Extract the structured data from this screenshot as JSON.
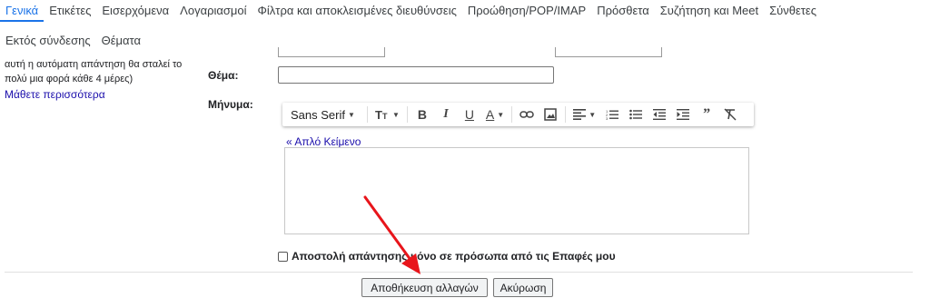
{
  "tabs_primary": [
    {
      "label": "Γενικά",
      "active": true
    },
    {
      "label": "Ετικέτες",
      "active": false
    },
    {
      "label": "Εισερχόμενα",
      "active": false
    },
    {
      "label": "Λογαριασμοί",
      "active": false
    },
    {
      "label": "Φίλτρα και αποκλεισμένες διευθύνσεις",
      "active": false
    },
    {
      "label": "Προώθηση/POP/IMAP",
      "active": false
    },
    {
      "label": "Πρόσθετα",
      "active": false
    },
    {
      "label": "Συζήτηση και Meet",
      "active": false
    },
    {
      "label": "Σύνθετες",
      "active": false
    }
  ],
  "tabs_secondary": [
    {
      "label": "Εκτός σύνδεσης"
    },
    {
      "label": "Θέματα"
    }
  ],
  "left_panel": {
    "note": "αυτή η αυτόματη απάντηση θα σταλεί το πολύ μια φορά κάθε 4 μέρες)",
    "learn_more": "Μάθετε περισσότερα"
  },
  "form": {
    "subject_label": "Θέμα:",
    "subject_value": "",
    "message_label": "Μήνυμα:",
    "plain_text_link": "« Απλό Κείμενο",
    "contacts_only_label": "Αποστολή απάντησης μόνο σε πρόσωπα από τις Επαφές μου"
  },
  "toolbar": {
    "font_name": "Sans Serif",
    "icons": [
      "font-family-dropdown",
      "text-size-icon",
      "bold-icon",
      "italic-icon",
      "underline-icon",
      "text-color-icon",
      "link-icon",
      "image-icon",
      "align-icon",
      "numbered-list-icon",
      "bulleted-list-icon",
      "indent-less-icon",
      "indent-more-icon",
      "quote-icon",
      "remove-formatting-icon"
    ]
  },
  "buttons": {
    "save": "Αποθήκευση αλλαγών",
    "cancel": "Ακύρωση"
  },
  "colors": {
    "accent": "#1a73e8",
    "link": "#1a0dab",
    "annotation_arrow": "#e8151b"
  }
}
